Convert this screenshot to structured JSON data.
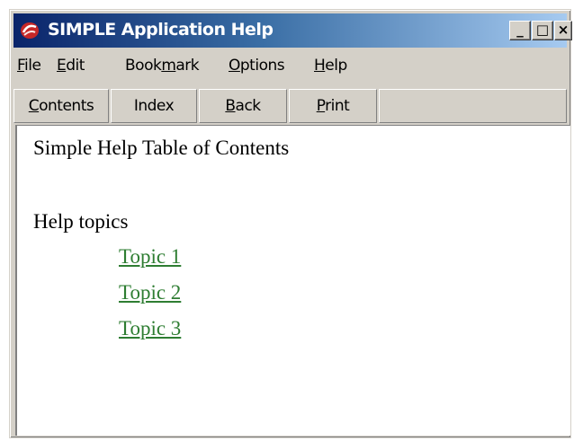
{
  "window": {
    "title": "SIMPLE Application Help",
    "controls": {
      "minimize": "_",
      "maximize": "□",
      "close": "×"
    }
  },
  "menu": {
    "items": [
      {
        "mnemonic": "F",
        "rest": "ile"
      },
      {
        "mnemonic": "E",
        "rest": "dit"
      },
      {
        "pre": "Book",
        "mnemonic": "m",
        "rest": "ark"
      },
      {
        "mnemonic": "O",
        "rest": "ptions"
      },
      {
        "mnemonic": "H",
        "rest": "elp"
      }
    ]
  },
  "toolbar": {
    "contents": {
      "mnemonic": "C",
      "rest": "ontents"
    },
    "index": {
      "pre": "",
      "mnemonic": "",
      "rest": "Index"
    },
    "back": {
      "mnemonic": "B",
      "rest": "ack"
    },
    "print": {
      "mnemonic": "P",
      "rest": "rint"
    }
  },
  "content": {
    "heading": "Simple Help Table of Contents",
    "topics_label": "Help topics",
    "topics": [
      "Topic 1",
      "Topic 2",
      "Topic 3"
    ],
    "link_color": "#2e7d32"
  },
  "colors": {
    "title_gradient_start": "#0a246a",
    "title_gradient_end": "#a6caf0",
    "chrome": "#d4d0c8"
  },
  "icons": {
    "app_icon": "red-swirl-app-icon"
  }
}
